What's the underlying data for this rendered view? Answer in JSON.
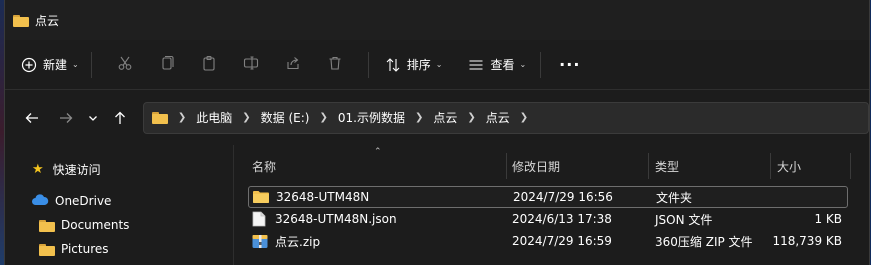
{
  "window": {
    "title": "点云"
  },
  "toolbar": {
    "new_label": "新建",
    "sort_label": "排序",
    "view_label": "查看",
    "more_label": "···"
  },
  "address": {
    "crumbs": [
      "此电脑",
      "数据 (E:)",
      "01.示例数据",
      "点云",
      "点云"
    ]
  },
  "sidebar": {
    "quick_access": "快速访问",
    "onedrive": "OneDrive",
    "items": [
      "Documents",
      "Pictures"
    ]
  },
  "columns": {
    "name": "名称",
    "date": "修改日期",
    "type": "类型",
    "size": "大小"
  },
  "files": [
    {
      "name": "32648-UTM48N",
      "date": "2024/7/29 16:56",
      "type": "文件夹",
      "size": "",
      "icon": "folder-icon"
    },
    {
      "name": "32648-UTM48N.json",
      "date": "2024/6/13 17:38",
      "type": "JSON 文件",
      "size": "1 KB",
      "icon": "document-icon"
    },
    {
      "name": "点云.zip",
      "date": "2024/7/29 16:59",
      "type": "360压缩 ZIP 文件",
      "size": "118,739 KB",
      "icon": "zip-archive-icon"
    }
  ],
  "colors": {
    "folder": "#f2c04d",
    "accent_star": "#f5c51f",
    "onedrive": "#3a8ee6"
  }
}
